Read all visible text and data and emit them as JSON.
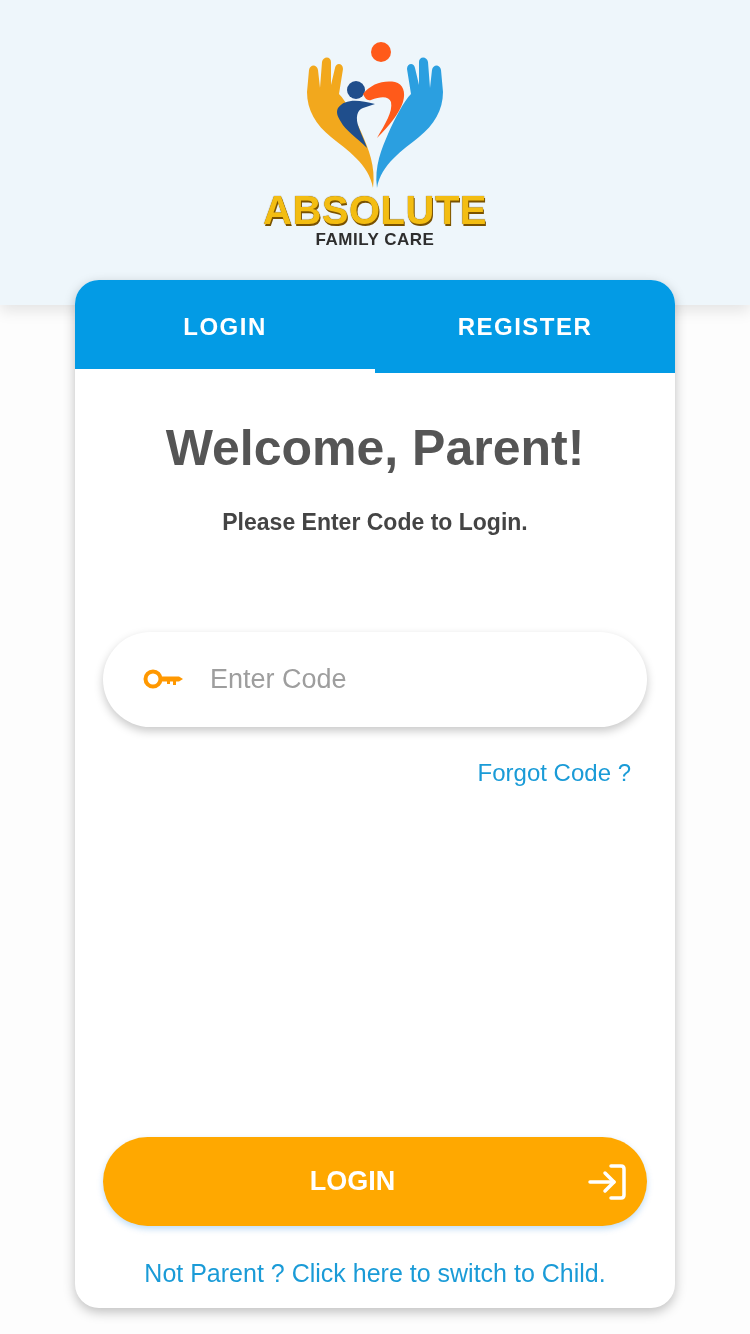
{
  "logo": {
    "title": "ABSOLUTE",
    "subtitle": "FAMILY CARE"
  },
  "tabs": [
    {
      "label": "LOGIN",
      "selected": true
    },
    {
      "label": "REGISTER",
      "selected": false
    }
  ],
  "heading": "Welcome, Parent!",
  "subheading": "Please Enter Code to Login.",
  "code_field": {
    "placeholder": "Enter Code"
  },
  "forgot_link": "Forgot Code ?",
  "login_button": {
    "label": "LOGIN"
  },
  "switch_link": "Not Parent ? Click here to switch to Child."
}
